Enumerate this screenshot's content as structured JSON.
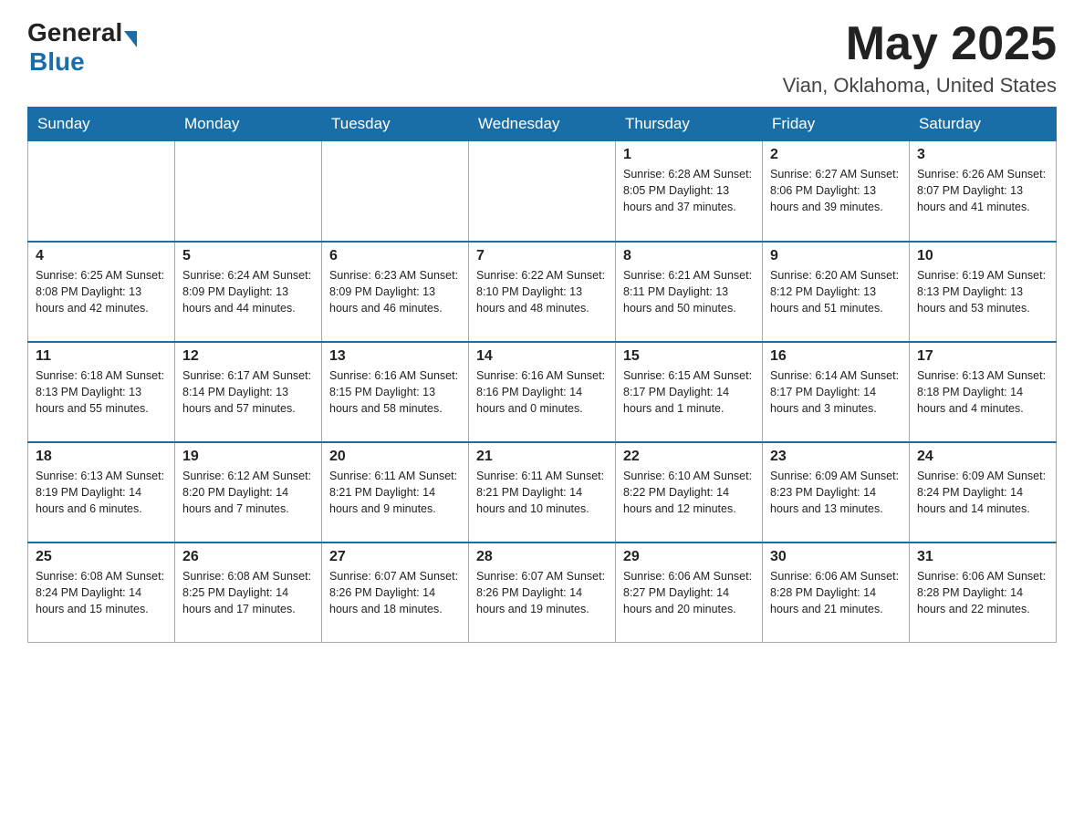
{
  "header": {
    "logo_general": "General",
    "logo_blue": "Blue",
    "month_title": "May 2025",
    "location": "Vian, Oklahoma, United States"
  },
  "weekdays": [
    "Sunday",
    "Monday",
    "Tuesday",
    "Wednesday",
    "Thursday",
    "Friday",
    "Saturday"
  ],
  "weeks": [
    [
      {
        "day": "",
        "info": ""
      },
      {
        "day": "",
        "info": ""
      },
      {
        "day": "",
        "info": ""
      },
      {
        "day": "",
        "info": ""
      },
      {
        "day": "1",
        "info": "Sunrise: 6:28 AM\nSunset: 8:05 PM\nDaylight: 13 hours and 37 minutes."
      },
      {
        "day": "2",
        "info": "Sunrise: 6:27 AM\nSunset: 8:06 PM\nDaylight: 13 hours and 39 minutes."
      },
      {
        "day": "3",
        "info": "Sunrise: 6:26 AM\nSunset: 8:07 PM\nDaylight: 13 hours and 41 minutes."
      }
    ],
    [
      {
        "day": "4",
        "info": "Sunrise: 6:25 AM\nSunset: 8:08 PM\nDaylight: 13 hours and 42 minutes."
      },
      {
        "day": "5",
        "info": "Sunrise: 6:24 AM\nSunset: 8:09 PM\nDaylight: 13 hours and 44 minutes."
      },
      {
        "day": "6",
        "info": "Sunrise: 6:23 AM\nSunset: 8:09 PM\nDaylight: 13 hours and 46 minutes."
      },
      {
        "day": "7",
        "info": "Sunrise: 6:22 AM\nSunset: 8:10 PM\nDaylight: 13 hours and 48 minutes."
      },
      {
        "day": "8",
        "info": "Sunrise: 6:21 AM\nSunset: 8:11 PM\nDaylight: 13 hours and 50 minutes."
      },
      {
        "day": "9",
        "info": "Sunrise: 6:20 AM\nSunset: 8:12 PM\nDaylight: 13 hours and 51 minutes."
      },
      {
        "day": "10",
        "info": "Sunrise: 6:19 AM\nSunset: 8:13 PM\nDaylight: 13 hours and 53 minutes."
      }
    ],
    [
      {
        "day": "11",
        "info": "Sunrise: 6:18 AM\nSunset: 8:13 PM\nDaylight: 13 hours and 55 minutes."
      },
      {
        "day": "12",
        "info": "Sunrise: 6:17 AM\nSunset: 8:14 PM\nDaylight: 13 hours and 57 minutes."
      },
      {
        "day": "13",
        "info": "Sunrise: 6:16 AM\nSunset: 8:15 PM\nDaylight: 13 hours and 58 minutes."
      },
      {
        "day": "14",
        "info": "Sunrise: 6:16 AM\nSunset: 8:16 PM\nDaylight: 14 hours and 0 minutes."
      },
      {
        "day": "15",
        "info": "Sunrise: 6:15 AM\nSunset: 8:17 PM\nDaylight: 14 hours and 1 minute."
      },
      {
        "day": "16",
        "info": "Sunrise: 6:14 AM\nSunset: 8:17 PM\nDaylight: 14 hours and 3 minutes."
      },
      {
        "day": "17",
        "info": "Sunrise: 6:13 AM\nSunset: 8:18 PM\nDaylight: 14 hours and 4 minutes."
      }
    ],
    [
      {
        "day": "18",
        "info": "Sunrise: 6:13 AM\nSunset: 8:19 PM\nDaylight: 14 hours and 6 minutes."
      },
      {
        "day": "19",
        "info": "Sunrise: 6:12 AM\nSunset: 8:20 PM\nDaylight: 14 hours and 7 minutes."
      },
      {
        "day": "20",
        "info": "Sunrise: 6:11 AM\nSunset: 8:21 PM\nDaylight: 14 hours and 9 minutes."
      },
      {
        "day": "21",
        "info": "Sunrise: 6:11 AM\nSunset: 8:21 PM\nDaylight: 14 hours and 10 minutes."
      },
      {
        "day": "22",
        "info": "Sunrise: 6:10 AM\nSunset: 8:22 PM\nDaylight: 14 hours and 12 minutes."
      },
      {
        "day": "23",
        "info": "Sunrise: 6:09 AM\nSunset: 8:23 PM\nDaylight: 14 hours and 13 minutes."
      },
      {
        "day": "24",
        "info": "Sunrise: 6:09 AM\nSunset: 8:24 PM\nDaylight: 14 hours and 14 minutes."
      }
    ],
    [
      {
        "day": "25",
        "info": "Sunrise: 6:08 AM\nSunset: 8:24 PM\nDaylight: 14 hours and 15 minutes."
      },
      {
        "day": "26",
        "info": "Sunrise: 6:08 AM\nSunset: 8:25 PM\nDaylight: 14 hours and 17 minutes."
      },
      {
        "day": "27",
        "info": "Sunrise: 6:07 AM\nSunset: 8:26 PM\nDaylight: 14 hours and 18 minutes."
      },
      {
        "day": "28",
        "info": "Sunrise: 6:07 AM\nSunset: 8:26 PM\nDaylight: 14 hours and 19 minutes."
      },
      {
        "day": "29",
        "info": "Sunrise: 6:06 AM\nSunset: 8:27 PM\nDaylight: 14 hours and 20 minutes."
      },
      {
        "day": "30",
        "info": "Sunrise: 6:06 AM\nSunset: 8:28 PM\nDaylight: 14 hours and 21 minutes."
      },
      {
        "day": "31",
        "info": "Sunrise: 6:06 AM\nSunset: 8:28 PM\nDaylight: 14 hours and 22 minutes."
      }
    ]
  ]
}
